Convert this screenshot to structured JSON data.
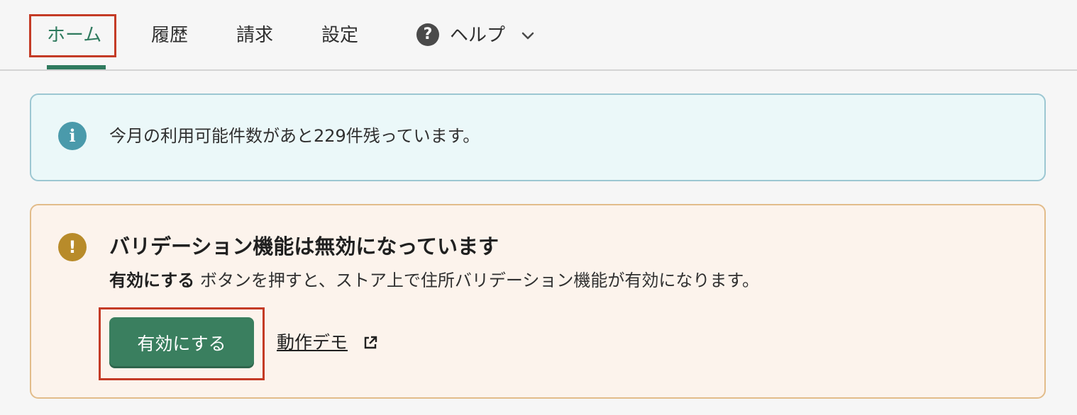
{
  "nav": {
    "tabs": [
      {
        "label": "ホーム",
        "active": true
      },
      {
        "label": "履歴"
      },
      {
        "label": "請求"
      },
      {
        "label": "設定"
      }
    ],
    "help": {
      "label": "ヘルプ",
      "icon": "question-circle-icon",
      "chevron": "chevron-down-icon"
    }
  },
  "info_banner": {
    "icon": "info-icon",
    "text": "今月の利用可能件数があと229件残っています。"
  },
  "warning_banner": {
    "icon": "exclamation-icon",
    "title": "バリデーション機能は無効になっています",
    "body_bold": "有効にする",
    "body_rest": " ボタンを押すと、ストア上で住所バリデーション機能が有効になります。",
    "enable_button": "有効にする",
    "demo_link": "動作デモ",
    "demo_link_icon": "external-link-icon"
  },
  "colors": {
    "accent": "#2f7a5e",
    "button": "#3a7f5f",
    "highlight": "#c43b26",
    "info_bg": "#ebf8f9",
    "warn_bg": "#fcf3ec"
  }
}
